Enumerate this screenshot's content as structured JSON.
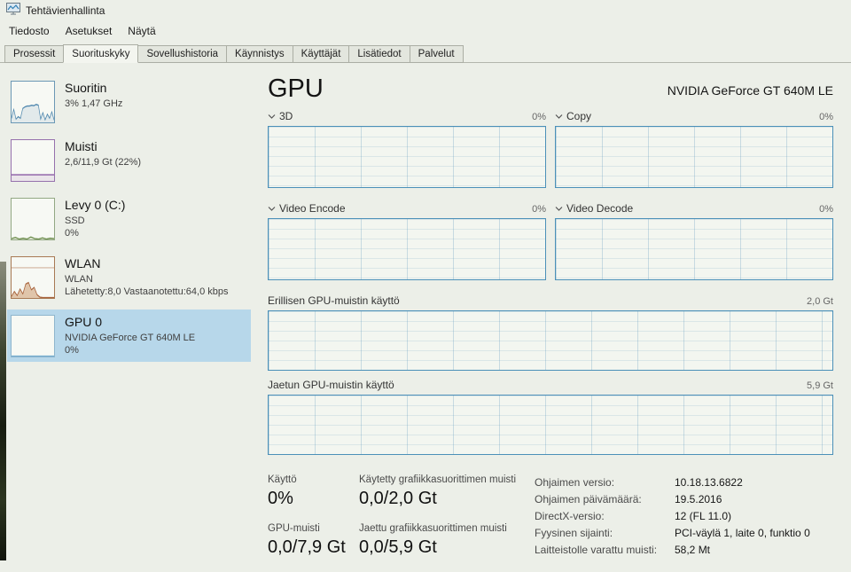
{
  "window": {
    "title": "Tehtävienhallinta"
  },
  "menu": {
    "items": [
      {
        "label": "Tiedosto"
      },
      {
        "label": "Asetukset"
      },
      {
        "label": "Näytä"
      }
    ]
  },
  "tabs": {
    "items": [
      {
        "label": "Prosessit",
        "selected": false
      },
      {
        "label": "Suorituskyky",
        "selected": true
      },
      {
        "label": "Sovellushistoria",
        "selected": false
      },
      {
        "label": "Käynnistys",
        "selected": false
      },
      {
        "label": "Käyttäjät",
        "selected": false
      },
      {
        "label": "Lisätiedot",
        "selected": false
      },
      {
        "label": "Palvelut",
        "selected": false
      }
    ]
  },
  "sidebar": {
    "items": [
      {
        "title": "Suoritin",
        "line1": "3% 1,47 GHz",
        "line2": "",
        "border": "#6b98b5",
        "selected": false,
        "spark": {
          "color": "#4e87ae",
          "fill": "rgba(78,135,174,0.12)",
          "points": [
            10,
            32,
            8,
            14,
            10,
            34,
            38,
            40,
            40,
            42,
            41,
            44,
            42,
            8,
            24,
            6,
            20,
            10,
            26,
            6
          ]
        }
      },
      {
        "title": "Muisti",
        "line1": "2,6/11,9 Gt (22%)",
        "line2": "",
        "border": "#9671ad",
        "selected": false,
        "spark": {
          "color": "#8a5ba3",
          "fill": "rgba(138,91,163,0.12)",
          "points": [
            15,
            15
          ]
        }
      },
      {
        "title": "Levy 0 (C:)",
        "line1": "SSD",
        "line2": "0%",
        "border": "#93a883",
        "selected": false,
        "spark": {
          "color": "#6f8f4f",
          "fill": "rgba(111,143,79,0.15)",
          "points": [
            2,
            5,
            1,
            3,
            1,
            6,
            2,
            1,
            4,
            1,
            3,
            2
          ]
        }
      },
      {
        "title": "WLAN",
        "line1": "WLAN",
        "line2": "Lähetetty:8,0 Vastaanotettu:64,0 kbps",
        "border": "#a87a54",
        "selected": false,
        "spark": {
          "color": "#a8633c",
          "fill": "rgba(190,120,60,0.40)",
          "hline": 26,
          "points": [
            4,
            16,
            6,
            22,
            10,
            34,
            38,
            20,
            26,
            8,
            2,
            1,
            1,
            1,
            1,
            1
          ]
        }
      },
      {
        "title": "GPU 0",
        "line1": "NVIDIA GeForce GT 640M LE",
        "line2": "0%",
        "border": "#8fb6cd",
        "selected": true,
        "spark": {
          "color": "#76aed0",
          "points": [
            1,
            1
          ]
        }
      }
    ]
  },
  "main": {
    "title": "GPU",
    "device": "NVIDIA GeForce GT 640M LE",
    "charts": [
      {
        "label": "3D",
        "value": "0%"
      },
      {
        "label": "Copy",
        "value": "0%"
      },
      {
        "label": "Video Encode",
        "value": "0%"
      },
      {
        "label": "Video Decode",
        "value": "0%"
      },
      {
        "label": "Erillisen GPU-muistin käyttö",
        "value": "2,0 Gt"
      },
      {
        "label": "Jaetun GPU-muistin käyttö",
        "value": "5,9 Gt"
      }
    ],
    "stats": [
      {
        "label": "Käyttö",
        "value": "0%"
      },
      {
        "label": "Käytetty grafiikkasuorittimen muisti",
        "value": "0,0/2,0 Gt"
      },
      {
        "label": "GPU-muisti",
        "value": "0,0/7,9 Gt"
      },
      {
        "label": "Jaettu grafiikkasuorittimen muisti",
        "value": "0,0/5,9 Gt"
      }
    ],
    "driver": [
      {
        "label": "Ohjaimen versio:",
        "value": "10.18.13.6822"
      },
      {
        "label": "Ohjaimen päivämäärä:",
        "value": "19.5.2016"
      },
      {
        "label": "DirectX-versio:",
        "value": "12 (FL 11.0)"
      },
      {
        "label": "Fyysinen sijainti:",
        "value": "PCI-väylä 1, laite 0, funktio 0"
      },
      {
        "label": "Laitteistolle varattu muisti:",
        "value": "58,2 Mt"
      }
    ]
  },
  "colors": {
    "accent_blue": "#4b90b8",
    "selected_item_bg": "#b7d7ea"
  },
  "icons": {
    "app_icon": "task-manager-monitor-icon",
    "chevron": "chevron-down-icon"
  }
}
